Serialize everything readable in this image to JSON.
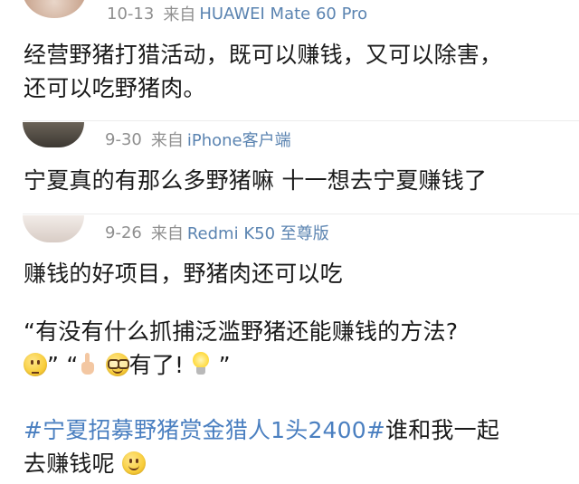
{
  "comments": [
    {
      "time": "10-13",
      "from": "来自",
      "device": "HUAWEI Mate 60 Pro",
      "lines": [
        "经营野猪打猎活动，既可以赚钱，又可以除害，",
        "还可以吃野猪肉。"
      ]
    },
    {
      "time": "9-30",
      "from": "来自",
      "device": "iPhone客户端",
      "lines": [
        "宁夏真的有那么多野猪嘛 十一想去宁夏赚钱了"
      ]
    },
    {
      "time": "9-26",
      "from": "来自",
      "device": "Redmi K50 至尊版",
      "lines": [
        "赚钱的好项目，野猪肉还可以吃",
        "“有没有什么抓捕泛滥野猪还能赚钱的方法?"
      ],
      "line3": {
        "q_close_1": "”",
        "q_open_2": "“",
        "q_open_3": "“",
        "text": "有了!",
        "q_close_end": "”"
      },
      "topic": "#宁夏招募野猪赏金猎人1头2400#",
      "after_topic": "谁和我一起",
      "last_line": "去赚钱呢"
    }
  ],
  "icons": {
    "emoji_1": "thinking-face-icon",
    "emoji_2": "pointing-up-hand-icon",
    "emoji_3": "nerd-face-icon",
    "emoji_4": "light-bulb-icon",
    "emoji_5": "smiling-face-icon"
  },
  "colors": {
    "link": "#4a7fc0",
    "meta": "#8f8f8f",
    "device": "#5b84b1"
  }
}
